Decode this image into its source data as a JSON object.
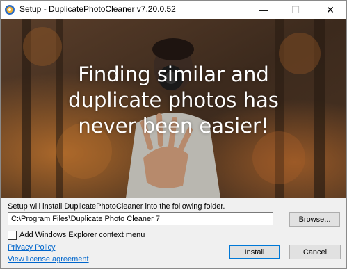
{
  "window": {
    "title": "Setup - DuplicatePhotoCleaner v7.20.0.52",
    "app_icon": "app-icon",
    "controls": {
      "minimize": "—",
      "maximize": "☐",
      "close": "✕"
    }
  },
  "banner": {
    "headline": [
      "Finding similar and",
      "duplicate photos has",
      "never been easier!"
    ]
  },
  "install": {
    "message": "Setup will install DuplicatePhotoCleaner into the following folder.",
    "path": "C:\\Program Files\\Duplicate Photo Cleaner 7",
    "browse_label": "Browse...",
    "checkbox_label": "Add Windows Explorer context menu",
    "checkbox_checked": false
  },
  "links": {
    "privacy": "Privacy Policy",
    "license": "View license agreement"
  },
  "buttons": {
    "install": "Install",
    "cancel": "Cancel"
  },
  "colors": {
    "accent": "#0078d7",
    "link": "#0066cc"
  }
}
